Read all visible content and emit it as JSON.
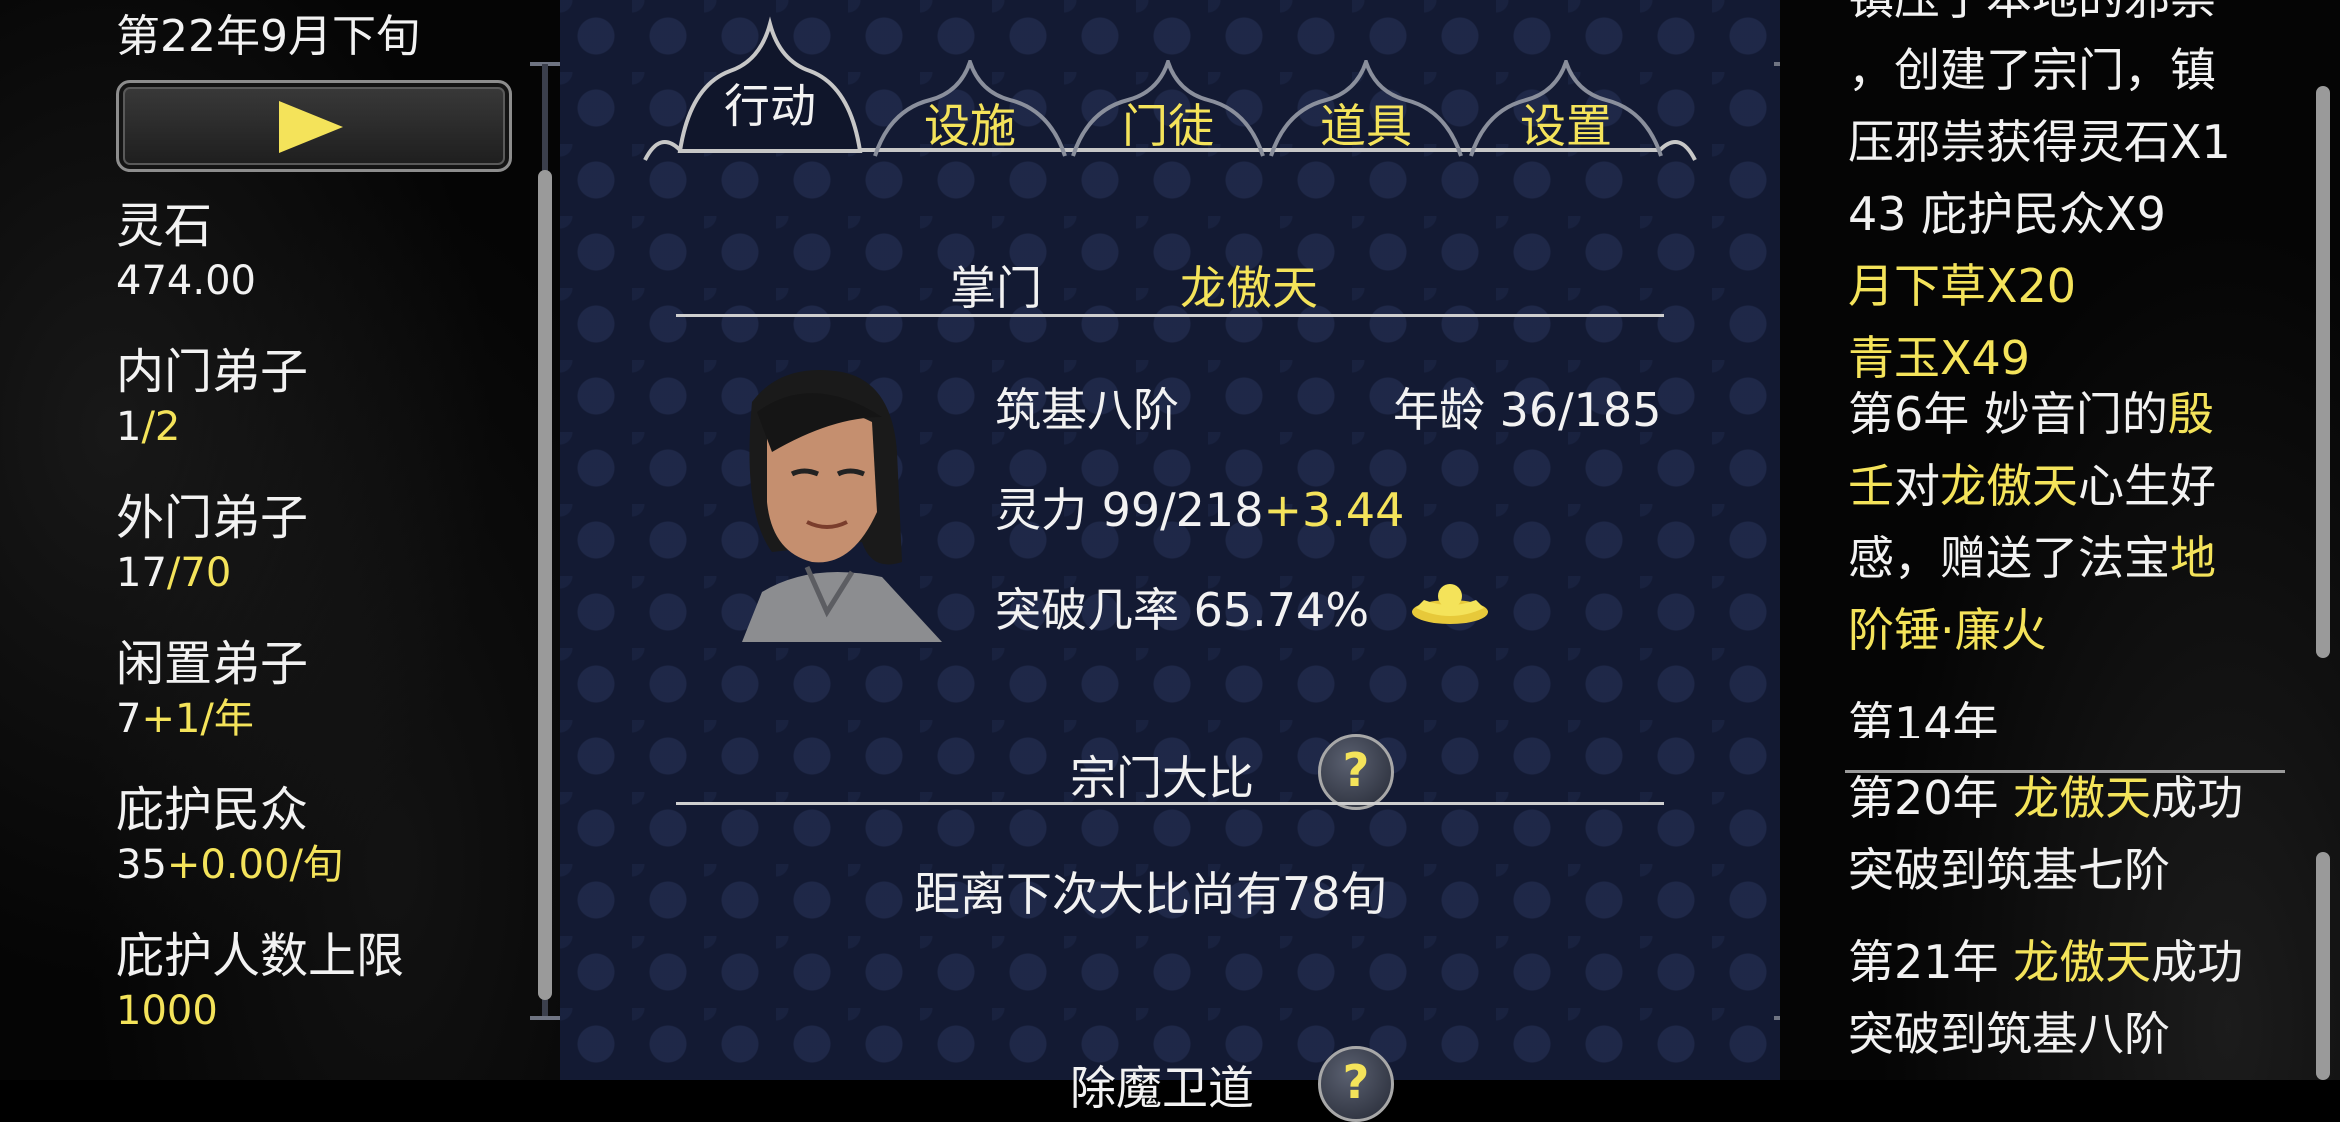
{
  "header": {
    "date": "第22年9月下旬"
  },
  "stats": [
    {
      "label": "灵石",
      "value": "474.00"
    },
    {
      "label": "内门弟子",
      "value_main": "1",
      "value_extra": "/2"
    },
    {
      "label": "外门弟子",
      "value_main": "17",
      "value_extra": "/70"
    },
    {
      "label": "闲置弟子",
      "value_main": "7",
      "value_extra": "+1/年"
    },
    {
      "label": "庇护民众",
      "value_main": "35",
      "value_extra": "+0.00/旬"
    },
    {
      "label": "庇护人数上限",
      "value": "1000"
    }
  ],
  "tabs": [
    "行动",
    "设施",
    "门徒",
    "道具",
    "设置"
  ],
  "sect_master": {
    "title": "掌门",
    "name": "龙傲天",
    "realm": "筑基八阶",
    "age_label": "年龄",
    "age_value": "36/185",
    "spirit_label": "灵力",
    "spirit_value": "99/218",
    "spirit_gain": "+3.44",
    "breakthrough_label": "突破几率",
    "breakthrough_value": "65.74%"
  },
  "tournament": {
    "title": "宗门大比",
    "help_mark": "?",
    "countdown": "距离下次大比尚有78旬"
  },
  "next_section": {
    "title": "除魔卫道",
    "help_mark": "?"
  },
  "log": {
    "line_clip": "镇压了本地的邪祟",
    "line1": "，创建了宗门，镇",
    "line2": "压邪祟获得灵石X1",
    "line3": "43 庇护民众X9",
    "line4": "月下草X20",
    "line5": "青玉X49",
    "entry2_a": "第6年 妙音门的",
    "entry2_b": "殷",
    "entry2_c": "壬",
    "entry2_d": "对",
    "entry2_e": "龙傲天",
    "entry2_f": "心生好",
    "entry2_g": "感，赠送了法宝",
    "entry2_h": "地",
    "entry2_i": "阶锤·廉火",
    "entry3": "第14年",
    "entry4_a": "第20年 ",
    "entry4_b": "龙傲天",
    "entry4_c": "成功",
    "entry4_d": "突破到筑基七阶",
    "entry5_a": "第21年 ",
    "entry5_b": "龙傲天",
    "entry5_c": "成功",
    "entry5_d": "突破到筑基八阶"
  },
  "colors": {
    "accent": "#f4e35a",
    "panel": "#131a33",
    "text": "#f2f2f2"
  }
}
